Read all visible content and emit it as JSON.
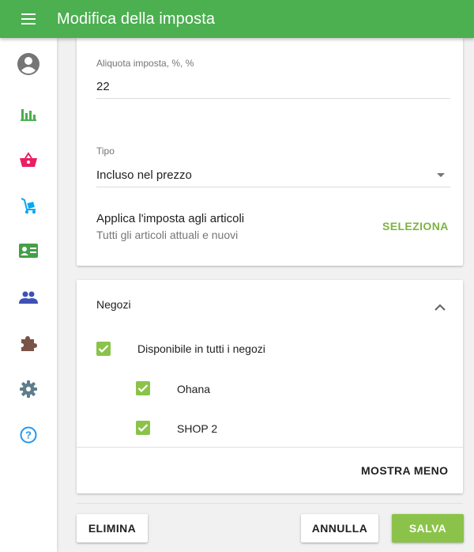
{
  "header": {
    "title": "Modifica della imposta",
    "menu_icon": "hamburger-menu-icon"
  },
  "sidebar": {
    "items": [
      {
        "icon": "account-circle-icon",
        "color": "#757575"
      },
      {
        "icon": "bar-chart-icon",
        "color": "#4caf50"
      },
      {
        "icon": "shopping-basket-icon",
        "color": "#e91e63"
      },
      {
        "icon": "hand-truck-icon",
        "color": "#03a9f4"
      },
      {
        "icon": "badge-card-icon",
        "color": "#43a047"
      },
      {
        "icon": "people-icon",
        "color": "#3f51b5"
      },
      {
        "icon": "puzzle-piece-icon",
        "color": "#795548"
      },
      {
        "icon": "settings-gear-icon",
        "color": "#607d8b"
      },
      {
        "icon": "help-circle-icon",
        "color": "#2196f3"
      }
    ]
  },
  "tax_form": {
    "rate_label": "Aliquota imposta, %, %",
    "rate_value": "22",
    "type_label": "Tipo",
    "type_value": "Incluso nel prezzo",
    "apply_title": "Applica l'imposta agli articoli",
    "apply_subtitle": "Tutti gli articoli attuali e nuovi",
    "select_button": "SELEZIONA"
  },
  "stores": {
    "title": "Negozi",
    "all_stores_label": "Disponibile in tutti i negozi",
    "all_stores_checked": true,
    "list": [
      {
        "name": "Ohana",
        "checked": true
      },
      {
        "name": "SHOP 2",
        "checked": true
      }
    ],
    "show_less_button": "MOSTRA MENO"
  },
  "footer": {
    "delete_button": "ELIMINA",
    "cancel_button": "ANNULLA",
    "save_button": "SALVA"
  },
  "colors": {
    "appbar": "#4caf50",
    "accent": "#8bc34a",
    "link": "#7cb342"
  }
}
